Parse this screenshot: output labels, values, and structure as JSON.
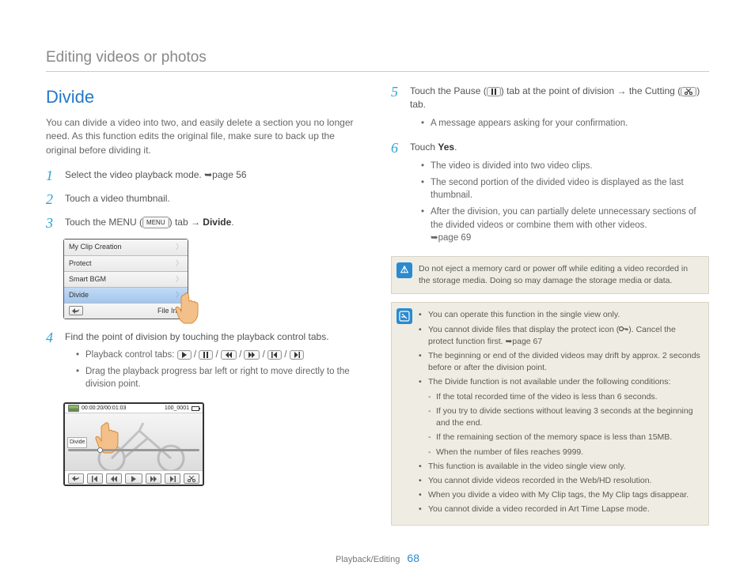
{
  "header": {
    "title": "Editing videos or photos"
  },
  "section": {
    "title": "Divide"
  },
  "intro": "You can divide a video into two, and easily delete a section you no longer need. As this function edits the original file, make sure to back up the original before dividing it.",
  "steps": {
    "s1": {
      "num": "1",
      "text_a": "Select the video playback mode. ",
      "page": "page 56"
    },
    "s2": {
      "num": "2",
      "text": "Touch a video thumbnail."
    },
    "s3": {
      "num": "3",
      "text_a": "Touch the MENU (",
      "btn": "MENU",
      "text_b": ") tab → ",
      "bold": "Divide",
      "text_c": "."
    },
    "s4": {
      "num": "4",
      "text": "Find the point of division by touching the playback control tabs.",
      "b1_a": "Playback control tabs: ",
      "b2": "Drag the playback progress bar left or right to move directly to the division point."
    },
    "s5": {
      "num": "5",
      "text_a": "Touch the Pause (",
      "text_b": ") tab at the point of division → the Cutting (",
      "text_c": ") tab.",
      "b1": "A message appears asking for your confirmation."
    },
    "s6": {
      "num": "6",
      "text_a": "Touch ",
      "bold": "Yes",
      "text_b": ".",
      "b1": "The video is divided into two video clips.",
      "b2": "The second portion of the divided video is displayed as the last thumbnail.",
      "b3": "After the division, you can partially delete unnecessary sections of the divided videos or combine them with other videos. ",
      "page": "page 69"
    }
  },
  "menu": {
    "items": [
      "My Clip Creation",
      "Protect",
      "Smart BGM",
      "Divide",
      "File Info"
    ],
    "selected_index": 3
  },
  "player": {
    "timecode": "00:00:20/00:01:03",
    "clipname": "100_0001",
    "sidelabel": "Divide"
  },
  "warn_note": "Do not eject a memory card or power off while editing a video recorded in the storage media. Doing so may damage the storage media or data.",
  "info_note": {
    "n1": "You can operate this function in the single view only.",
    "n2a": "You cannot divide files that display the protect icon (",
    "n2b": "). Cancel the protect function first. ",
    "n2page": "page 67",
    "n3": "The beginning or end of the divided videos may drift by approx. 2 seconds before or after the division point.",
    "n4": "The Divide function is not available under the following conditions:",
    "n4a": "If the total recorded time of the video is less than 6 seconds.",
    "n4b": "If you try to divide sections without leaving 3 seconds at the beginning and the end.",
    "n4c": "If the remaining section of the memory space is less than 15MB.",
    "n4d": "When the number of files reaches 9999.",
    "n5": "This function is available in the video single view only.",
    "n6": "You cannot divide videos recorded in the Web/HD resolution.",
    "n7": "When you divide a video with My Clip tags, the My Clip tags disappear.",
    "n8": "You cannot divide a video recorded in Art Time Lapse mode."
  },
  "footer": {
    "section": "Playback/Editing",
    "page": "68"
  }
}
